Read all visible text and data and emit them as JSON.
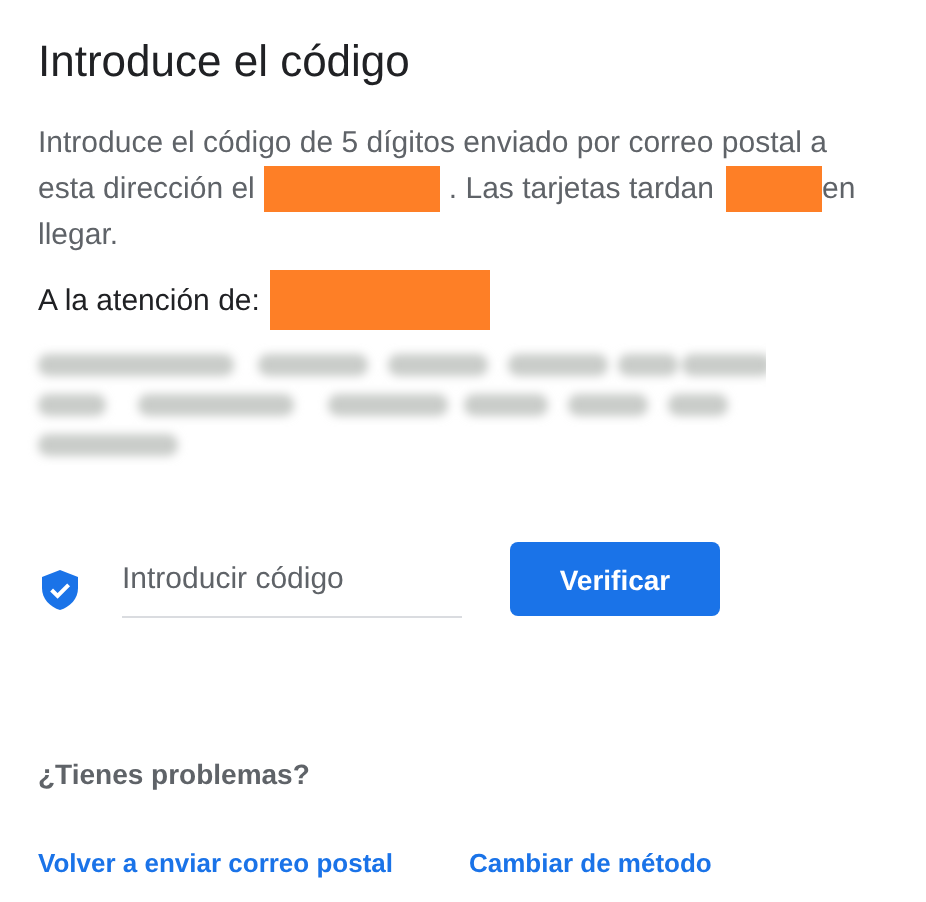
{
  "title": "Introduce el código",
  "description": [
    [
      {
        "kind": "text",
        "text": "Introduce el código de 5 dígitos enviado por correo postal a"
      }
    ],
    [
      {
        "kind": "text",
        "text": "esta dirección el"
      },
      {
        "kind": "redaction"
      },
      {
        "kind": "text",
        "text": ". Las tarjetas tardan"
      },
      {
        "kind": "redaction"
      },
      {
        "kind": "text",
        "text": "en"
      }
    ],
    [
      {
        "kind": "text",
        "text": "llegar."
      }
    ]
  ],
  "attention": {
    "label": "A la atención de:"
  },
  "address": {
    "kind": "blurred"
  },
  "code_field": {
    "placeholder": "Introducir código"
  },
  "verify_button": "Verificar",
  "help": {
    "heading": "¿Tienes problemas?",
    "links": [
      "Volver a enviar correo postal",
      "Cambiar de método"
    ]
  }
}
